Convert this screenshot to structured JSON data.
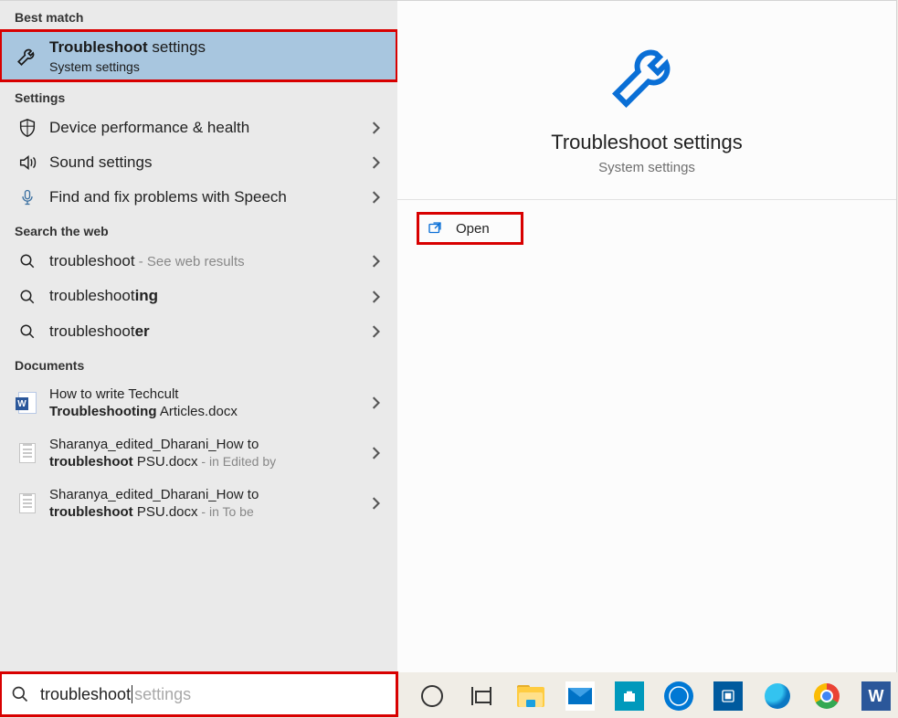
{
  "sections": {
    "best_match": "Best match",
    "settings": "Settings",
    "search_web": "Search the web",
    "documents": "Documents"
  },
  "best_match_item": {
    "title_prefix": "Troubleshoot",
    "title_rest": " settings",
    "subtitle": "System settings"
  },
  "settings_items": [
    {
      "label": "Device performance & health",
      "icon": "shield"
    },
    {
      "label": "Sound settings",
      "icon": "sound"
    },
    {
      "label": "Find and fix problems with Speech",
      "icon": "mic"
    }
  ],
  "web_items": [
    {
      "prefix": "troubleshoot",
      "bold": "",
      "suffix": " - See web results"
    },
    {
      "prefix": "troubleshoot",
      "bold": "ing",
      "suffix": ""
    },
    {
      "prefix": "troubleshoot",
      "bold": "er",
      "suffix": ""
    }
  ],
  "doc_items": [
    {
      "line1_a": "How to write Techcult ",
      "line1_b": "",
      "line2_a": "",
      "line2_bold": "Troubleshooting",
      "line2_b": " Articles.docx",
      "suffix": "",
      "type": "word"
    },
    {
      "line1_a": "Sharanya_edited_Dharani_How to ",
      "line1_b": "",
      "line2_a": "",
      "line2_bold": "troubleshoot",
      "line2_b": " PSU.docx",
      "suffix": " - in Edited by",
      "type": "doc"
    },
    {
      "line1_a": "Sharanya_edited_Dharani_How to ",
      "line1_b": "",
      "line2_a": "",
      "line2_bold": "troubleshoot",
      "line2_b": " PSU.docx",
      "suffix": " - in To be",
      "type": "doc"
    }
  ],
  "preview": {
    "title": "Troubleshoot settings",
    "subtitle": "System settings",
    "open": "Open"
  },
  "search": {
    "typed": "troubleshoot",
    "ghost": " settings"
  }
}
